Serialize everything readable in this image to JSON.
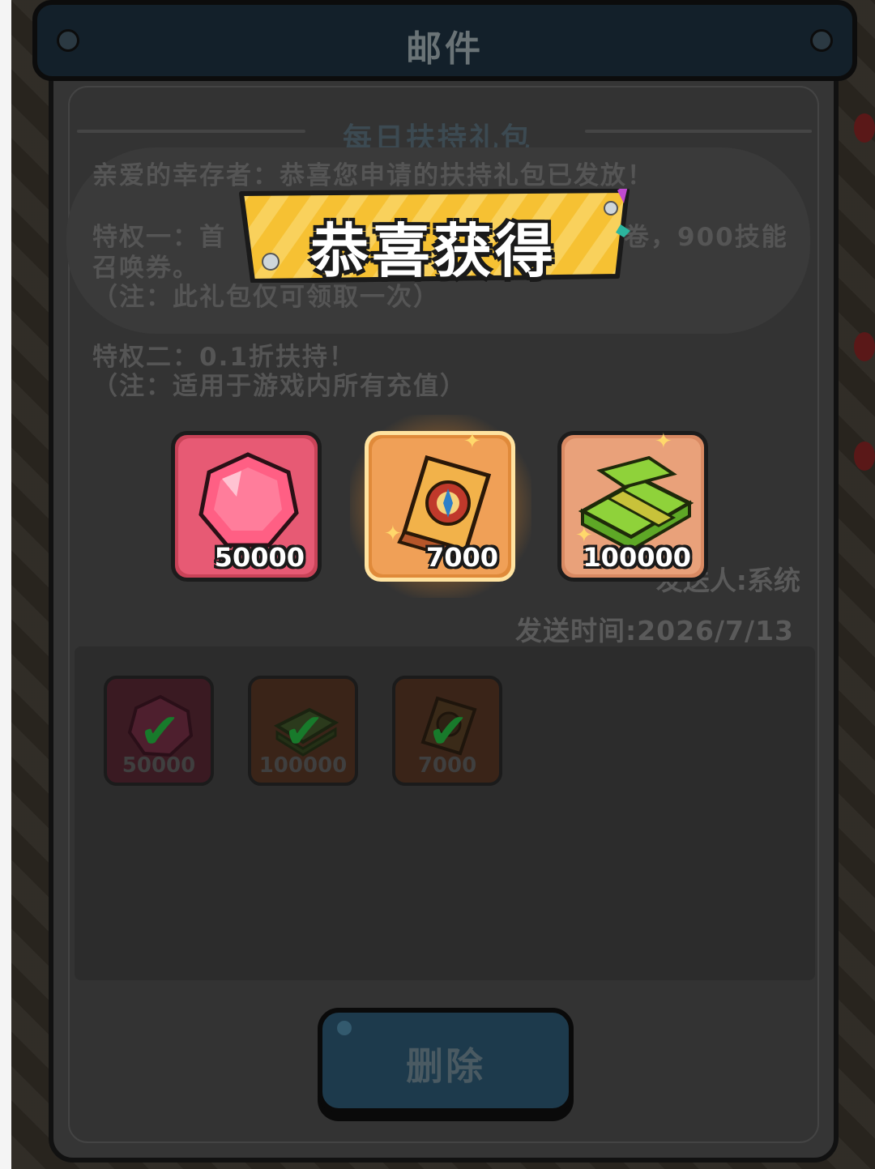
{
  "header": {
    "title": "邮件"
  },
  "mail": {
    "subject": "每日扶持礼包",
    "lines": [
      "亲爱的幸存者：恭喜您申请的扶持礼包已发放！",
      "特权一：首",
      "卷，900技能",
      "召唤券。",
      "（注：此礼包仅可领取一次）",
      "特权二：0.1折扶持！",
      "（注：适用于游戏内所有充值）"
    ],
    "sender": "发送人:系统",
    "send_time": "发送时间:2026/7/13"
  },
  "attachments": [
    {
      "icon": "gem-icon",
      "quantity": "50000",
      "claimed": true
    },
    {
      "icon": "cash-icon",
      "quantity": "100000",
      "claimed": true
    },
    {
      "icon": "ticket-icon",
      "quantity": "7000",
      "claimed": true
    }
  ],
  "reward_popup": {
    "title": "恭喜获得",
    "items": [
      {
        "icon": "gem-icon",
        "quantity": "50000",
        "color": "#e2506a"
      },
      {
        "icon": "summon-ticket-icon",
        "quantity": "7000",
        "color": "#e08a3a"
      },
      {
        "icon": "cash-icon",
        "quantity": "100000",
        "color": "#d98a63"
      }
    ]
  },
  "buttons": {
    "delete": "删除"
  },
  "colors": {
    "banner": "#f6c133",
    "overlay": "#1b1c1d",
    "delete_button": "#1d3a4c"
  }
}
